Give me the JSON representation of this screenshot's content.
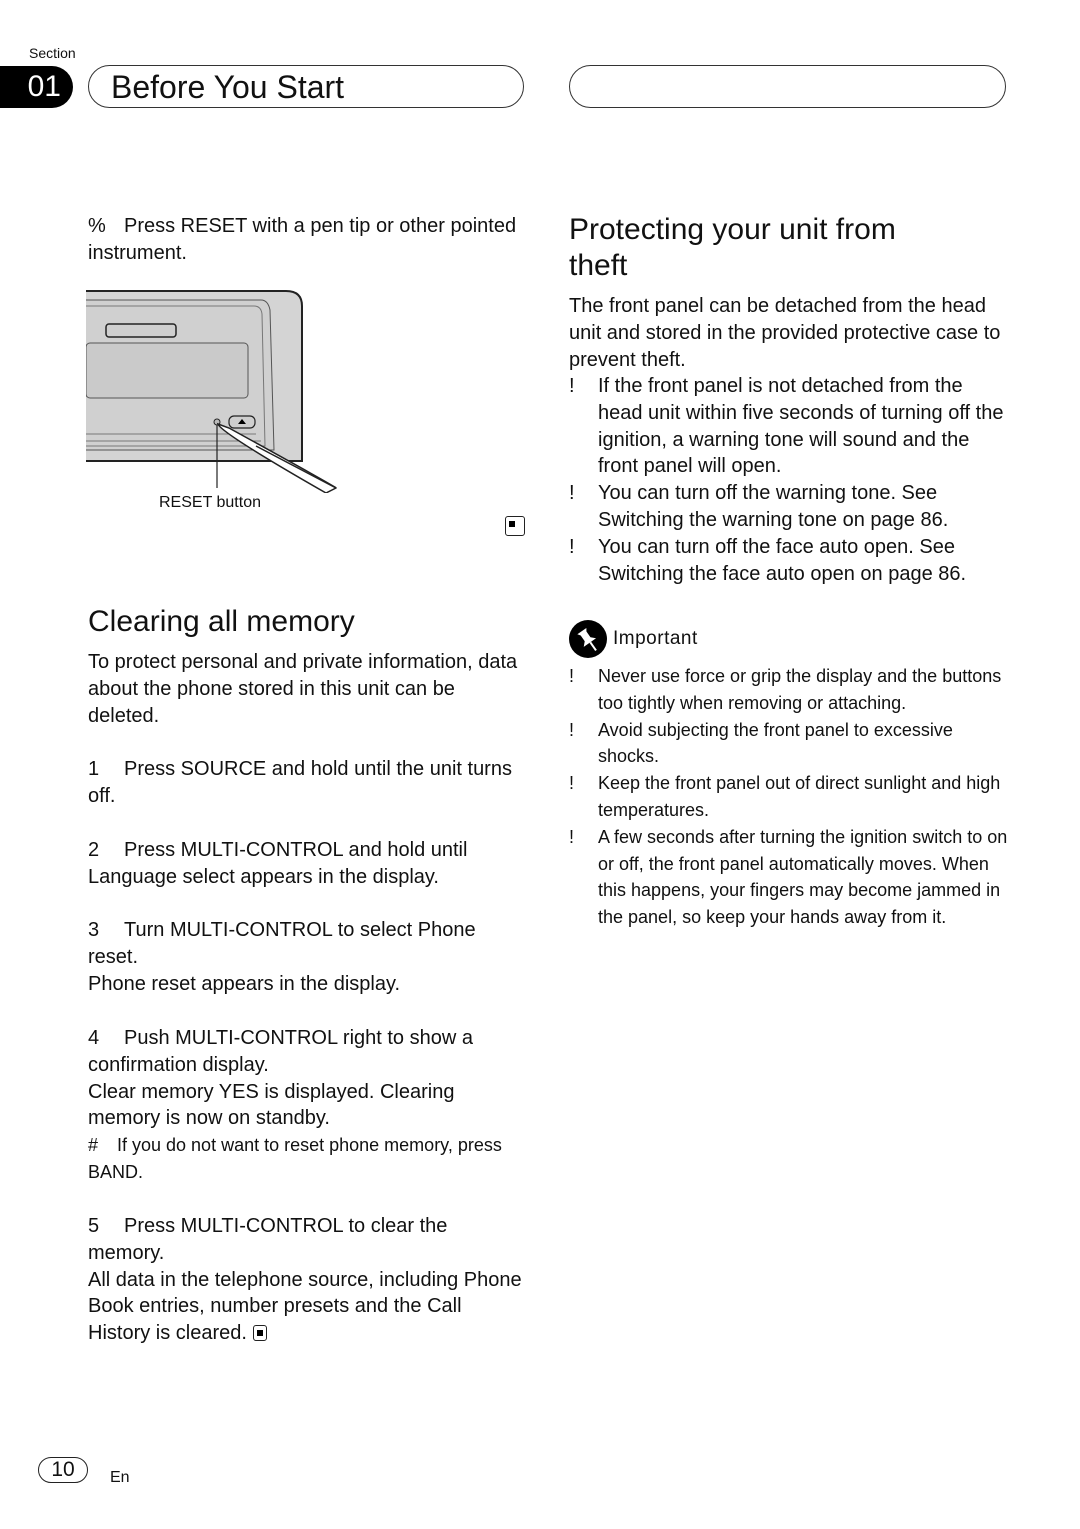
{
  "header": {
    "section_label": "Section",
    "section_number": "01",
    "section_title": "Before You Start"
  },
  "reset": {
    "instruction_marker": "%",
    "instruction": "Press RESET with a pen tip or other pointed instrument.",
    "figure_caption": "RESET button"
  },
  "clearing": {
    "heading": "Clearing all memory",
    "intro": "To protect personal and private information, data about the phone stored in this unit can be deleted.",
    "steps": [
      {
        "num": "1",
        "text": "Press SOURCE and hold until the unit turns off."
      },
      {
        "num": "2",
        "text": "Press MULTI-CONTROL and hold until Language select appears in the display."
      },
      {
        "num": "3",
        "text": "Turn MULTI-CONTROL to select Phone reset.",
        "result": "Phone reset appears in the display."
      },
      {
        "num": "4",
        "text": "Push MULTI-CONTROL right to show a confirmation display.",
        "result": "Clear memory YES is displayed. Clearing memory is now on standby.",
        "note_marker": "#",
        "note": "If you do not want to reset phone memory, press BAND."
      },
      {
        "num": "5",
        "text": "Press MULTI-CONTROL to clear the memory.",
        "result": "All data in the telephone source, including Phone Book entries, number presets and the Call History is cleared."
      }
    ]
  },
  "protecting": {
    "heading": "Protecting your unit from theft",
    "intro": "The front panel can be detached from the head unit and stored in the provided protective case to prevent theft.",
    "bullet_marker": "!",
    "bullets": [
      "If the front panel is not detached from the head unit within five seconds of turning off the ignition, a warning tone will sound and the front panel will open.",
      "You can turn off the warning tone. See Switching the warning tone on page 86.",
      "You can turn off the face auto open. See Switching the face auto open on page 86."
    ]
  },
  "important": {
    "label": "Important",
    "bullets": [
      "Never use force or grip the display and the buttons too tightly when removing or attaching.",
      "Avoid subjecting the front panel to excessive shocks.",
      "Keep the front panel out of direct sunlight and high temperatures.",
      "A few seconds after turning the ignition switch to on or off, the front panel automatically moves. When this happens, your fingers may become jammed in the panel, so keep your hands away from it."
    ]
  },
  "footer": {
    "page_number": "10",
    "language": "En"
  }
}
